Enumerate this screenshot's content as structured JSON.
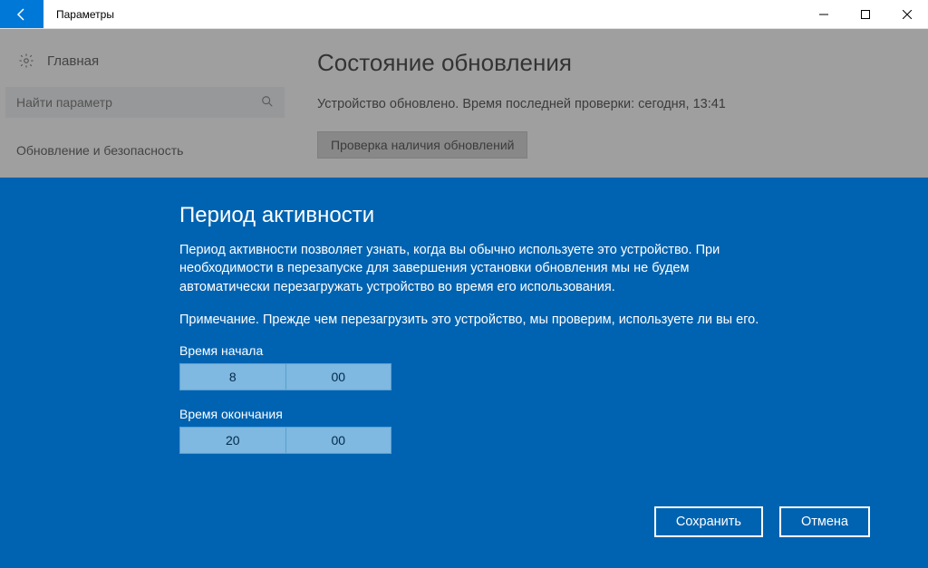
{
  "title": "Параметры",
  "sidebar": {
    "home": "Главная",
    "search_placeholder": "Найти параметр",
    "section": "Обновление и безопасность"
  },
  "main": {
    "heading": "Состояние обновления",
    "status": "Устройство обновлено. Время последней проверки: сегодня, 13:41",
    "check_btn": "Проверка наличия обновлений"
  },
  "dialog": {
    "title": "Период активности",
    "p1": "Период активности позволяет узнать, когда вы обычно используете это устройство. При необходимости в перезапуске для завершения установки обновления мы не будем автоматически перезагружать устройство во время его использования.",
    "p2": "Примечание. Прежде чем перезагрузить это устройство, мы проверим, используете ли вы его.",
    "start_label": "Время начала",
    "start_h": "8",
    "start_m": "00",
    "end_label": "Время окончания",
    "end_h": "20",
    "end_m": "00",
    "save": "Сохранить",
    "cancel": "Отмена"
  }
}
